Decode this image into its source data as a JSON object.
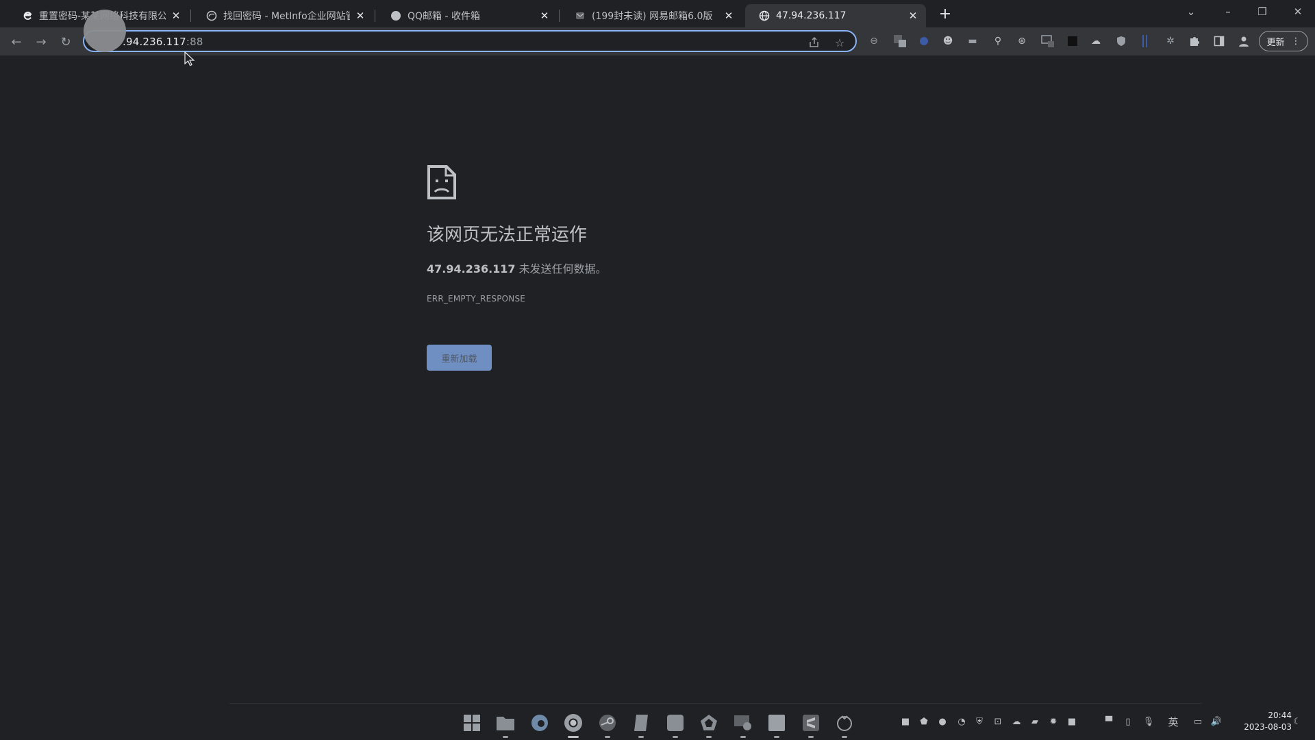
{
  "tabs": [
    {
      "title": "重置密码-某某网络科技有限公司",
      "icon": "edge-e-icon",
      "active": false
    },
    {
      "title": "找回密码 - MetInfo企业网站管理",
      "icon": "cloud-icon",
      "active": false
    },
    {
      "title": "QQ邮箱 - 收件箱",
      "icon": "globe-icon",
      "active": false
    },
    {
      "title": "(199封未读) 网易邮箱6.0版",
      "icon": "mail-icon",
      "active": false
    },
    {
      "title": "47.94.236.117",
      "icon": "globe-icon",
      "active": true
    }
  ],
  "address_bar": {
    "host": ".94.236.117",
    "port": ":88"
  },
  "toolbar": {
    "update_label": "更新"
  },
  "error_page": {
    "title": "该网页无法正常运作",
    "host_bold": "47.94.236.117",
    "message_suffix": " 未发送任何数据。",
    "error_code": "ERR_EMPTY_RESPONSE",
    "reload_label": "重新加载"
  },
  "taskbar": {
    "input_method": "英",
    "time": "20:44",
    "date": "2023-08-03"
  },
  "colors": {
    "accent": "#8ab4f8",
    "page_bg": "#202124",
    "toolbar_bg": "#35363a"
  }
}
